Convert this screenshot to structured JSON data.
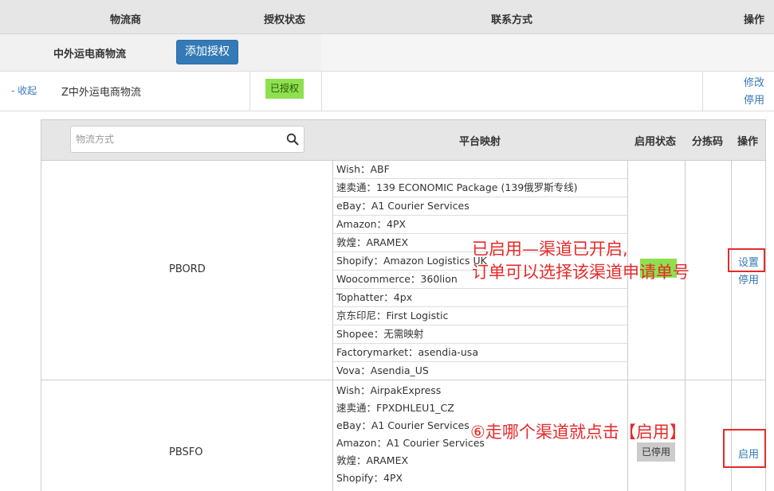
{
  "header": {
    "col_provider": "物流商",
    "col_auth": "授权状态",
    "col_contact": "联系方式",
    "col_ops": "操作"
  },
  "provider": {
    "name": "中外运电商物流",
    "add_button": "添加授权",
    "collapse_link": "- 收起",
    "detail_name": "Z中外运电商物流",
    "auth_status": "已授权",
    "modify_link": "修改",
    "disable_link": "停用"
  },
  "channels": {
    "search_placeholder": "物流方式",
    "col_mapping": "平台映射",
    "col_status": "启用状态",
    "col_sort_code": "分拣码",
    "col_ops": "操作",
    "rows": [
      {
        "name": "PBORD",
        "mappings": [
          "Wish：ABF",
          "速卖通：139 ECONOMIC Package (139俄罗斯专线)",
          "eBay：A1 Courier Services",
          "Amazon：4PX",
          "敦煌：ARAMEX",
          "Shopify：Amazon Logistics UK",
          "Woocommerce：360lion",
          "Tophatter：4px",
          "京东印尼：First Logistic",
          "Shopee：无需映射",
          "Factorymarket：asendia-usa",
          "Vova：Asendia_US"
        ],
        "settings_link": "设置",
        "disable_link": "停用"
      },
      {
        "name": "PBSFO",
        "mappings": [
          "Wish：AirpakExpress",
          "速卖通：FPXDHLEU1_CZ",
          "eBay：A1 Courier Services",
          "Amazon：A1 Courier Services",
          "敦煌：ARAMEX",
          "Shopify：4PX"
        ],
        "status": "已停用",
        "enable_link": "启用"
      }
    ]
  },
  "annotations": {
    "note1_line1": "已启用—渠道已开启,",
    "note1_line2": "订单可以选择该渠道申请单号",
    "note2": "⑥走哪个渠道就点击【启用】"
  },
  "colors": {
    "accent": "#337ab7",
    "authorized": "#8ee050",
    "annotation": "#e62a2a"
  }
}
